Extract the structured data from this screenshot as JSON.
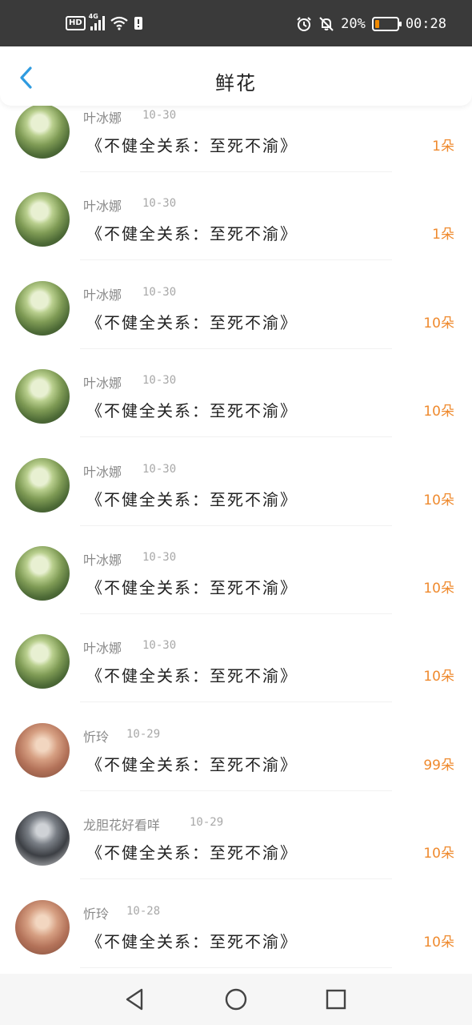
{
  "status_bar": {
    "hd": "HD",
    "network": "4G",
    "battery_percent": "20%",
    "battery_level": 0.2,
    "time": "00:28",
    "icons": [
      "signal-icon",
      "wifi-icon",
      "sim-alert-icon",
      "alarm-icon",
      "mute-bell-icon",
      "battery-icon"
    ]
  },
  "header": {
    "title": "鲜花"
  },
  "items": [
    {
      "name": "叶冰娜",
      "date": "10-30",
      "gift": "《不健全关系：至死不渝》",
      "count": "1朵",
      "avatar": "green"
    },
    {
      "name": "叶冰娜",
      "date": "10-30",
      "gift": "《不健全关系：至死不渝》",
      "count": "1朵",
      "avatar": "green"
    },
    {
      "name": "叶冰娜",
      "date": "10-30",
      "gift": "《不健全关系：至死不渝》",
      "count": "10朵",
      "avatar": "green"
    },
    {
      "name": "叶冰娜",
      "date": "10-30",
      "gift": "《不健全关系：至死不渝》",
      "count": "10朵",
      "avatar": "green"
    },
    {
      "name": "叶冰娜",
      "date": "10-30",
      "gift": "《不健全关系：至死不渝》",
      "count": "10朵",
      "avatar": "green"
    },
    {
      "name": "叶冰娜",
      "date": "10-30",
      "gift": "《不健全关系：至死不渝》",
      "count": "10朵",
      "avatar": "green"
    },
    {
      "name": "叶冰娜",
      "date": "10-30",
      "gift": "《不健全关系：至死不渝》",
      "count": "10朵",
      "avatar": "green"
    },
    {
      "name": "忻玲",
      "date": "10-29",
      "gift": "《不健全关系：至死不渝》",
      "count": "99朵",
      "avatar": "warm"
    },
    {
      "name": "龙胆花好看咩",
      "date": "10-29",
      "gift": "《不健全关系：至死不渝》",
      "count": "10朵",
      "avatar": "dark"
    },
    {
      "name": "忻玲",
      "date": "10-28",
      "gift": "《不健全关系：至死不渝》",
      "count": "10朵",
      "avatar": "warm"
    }
  ],
  "nav": {
    "icons": [
      "back-triangle-icon",
      "home-circle-icon",
      "recents-square-icon"
    ]
  },
  "colors": {
    "accent": "#2f9be0",
    "count": "#ef8a2e",
    "status_bar": "#3a3a3a",
    "battery": "#f08a00"
  }
}
